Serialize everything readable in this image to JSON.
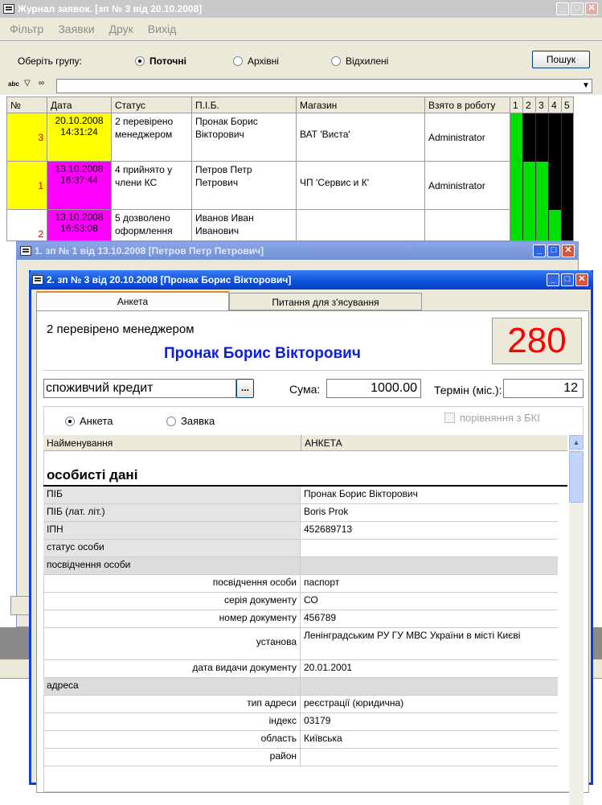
{
  "main_window": {
    "title": "Журнал заявок. [зп № 3 від 20.10.2008]",
    "menu": [
      "Фільтр",
      "Заявки",
      "Друк",
      "Вихід"
    ],
    "group_label": "Оберіть групу:",
    "groups": [
      {
        "label": "Поточні",
        "selected": true
      },
      {
        "label": "Архівні",
        "selected": false
      },
      {
        "label": "Відхилені",
        "selected": false
      }
    ],
    "search_button": "Пошук",
    "columns": [
      "№",
      "Дата",
      "Статус",
      "П.І.Б.",
      "Магазин",
      "Взято в роботу",
      "1",
      "2",
      "3",
      "4",
      "5"
    ],
    "rows": [
      {
        "num": "3",
        "date": "20.10.2008",
        "time": "14:31:24",
        "status": "2 перевірено менеджером",
        "name": "Пронак Борис Вікторович",
        "shop": "ВАТ 'Виста'",
        "taken": "Administrator",
        "row_color": "#ffff00",
        "date_color": "#ffff00",
        "stages": [
          "#00e000",
          "#000000",
          "#000000",
          "#000000",
          "#000000"
        ]
      },
      {
        "num": "1",
        "date": "13.10.2008",
        "time": "16:37:44",
        "status": "4 прийнято у члени КС",
        "name": "Петров Петр Петрович",
        "shop": "ЧП 'Сервис и К'",
        "taken": "Administrator",
        "row_color": "#ffff00",
        "date_color": "#ff00ff",
        "stages": [
          "#00e000",
          "#00e000",
          "#00e000",
          "#000000",
          "#000000"
        ]
      },
      {
        "num": "2",
        "date": "13.10.2008",
        "time": "16:53:08",
        "status": "5 дозволено оформлення",
        "name": "Иванов Иван Иванович",
        "shop": "",
        "taken": "",
        "row_color": "#ffffff",
        "date_color": "#ff00ff",
        "stages": [
          "#00e000",
          "#00e000",
          "#00e000",
          "#00e000",
          "#000000"
        ]
      }
    ]
  },
  "window1": {
    "title": "1. зп № 1 від 13.10.2008 [Петров Петр Петрович]"
  },
  "window2": {
    "title": "2. зп № 3 від 20.10.2008 [Пронак Борис Вікторович]",
    "tabs": [
      "Анкета",
      "Питання для з'ясування"
    ],
    "status_text": "2 перевірено менеджером",
    "client_name": "Пронак Борис Вікторович",
    "score": "280",
    "product": "споживчий кредит",
    "browse_button": "...",
    "sum_label": "Сума:",
    "sum_value": "1000.00",
    "term_label": "Термін (міс.):",
    "term_value": "12",
    "view_options": [
      {
        "label": "Анкета",
        "selected": true
      },
      {
        "label": "Заявка",
        "selected": false
      }
    ],
    "bki_label": "порівняння з БКІ",
    "col_name": "Найменування",
    "col_value": "АНКЕТА",
    "section_title": "особисті дані",
    "fields": [
      {
        "label": "ПІБ",
        "value": "Пронак Борис Вікторович",
        "type": "field"
      },
      {
        "label": "ПІБ (лат. літ.)",
        "value": "Boris Prok",
        "type": "field"
      },
      {
        "label": "ІПН",
        "value": "452689713",
        "type": "field"
      },
      {
        "label": "статус особи",
        "value": "",
        "type": "field"
      },
      {
        "label": "посвідчення особи",
        "value": "",
        "type": "section"
      },
      {
        "label": "посвідчення особи",
        "value": "паспорт",
        "type": "sub"
      },
      {
        "label": "серія документу",
        "value": "СО",
        "type": "sub"
      },
      {
        "label": "номер документу",
        "value": "456789",
        "type": "sub"
      },
      {
        "label": "установа",
        "value": "Ленінградським РУ ГУ МВС України в місті Києві",
        "type": "sub-tall"
      },
      {
        "label": "дата видачи документу",
        "value": "20.01.2001",
        "type": "sub"
      },
      {
        "label": "адреса",
        "value": "",
        "type": "section"
      },
      {
        "label": "тип адреси",
        "value": "реєстрації (юридична)",
        "type": "sub"
      },
      {
        "label": "індекс",
        "value": "03179",
        "type": "sub"
      },
      {
        "label": "область",
        "value": "Київська",
        "type": "sub"
      },
      {
        "label": "район",
        "value": "",
        "type": "sub"
      }
    ]
  }
}
